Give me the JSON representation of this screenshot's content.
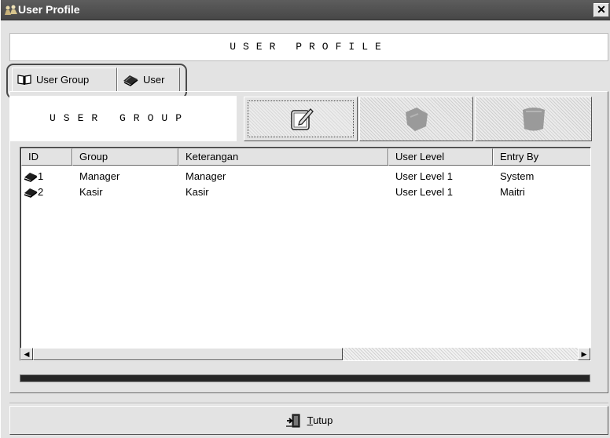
{
  "window": {
    "title": "User Profile",
    "close_glyph": "✕",
    "icon": "users-icon"
  },
  "banner": {
    "text": "USER PROFILE"
  },
  "tabs": [
    {
      "label": "User Group",
      "icon": "book-icon",
      "selected": true
    },
    {
      "label": "User",
      "icon": "user-book-icon",
      "selected": false
    }
  ],
  "group_panel": {
    "label": "USER GROUP",
    "buttons": [
      {
        "name": "new",
        "icon": "new-document-icon",
        "enabled": true
      },
      {
        "name": "edit",
        "icon": "edit-icon",
        "enabled": false
      },
      {
        "name": "delete",
        "icon": "delete-icon",
        "enabled": false
      }
    ]
  },
  "table": {
    "columns": [
      "ID",
      "Group",
      "Keterangan",
      "User Level",
      "Entry By"
    ],
    "rows": [
      {
        "id": "1",
        "group": "Manager",
        "keterangan": "Manager",
        "user_level": "User Level 1",
        "entry_by": "System"
      },
      {
        "id": "2",
        "group": "Kasir",
        "keterangan": "Kasir",
        "user_level": "User Level 1",
        "entry_by": "Maitri"
      }
    ]
  },
  "scrollbar": {
    "left_arrow": "◀",
    "right_arrow": "▶"
  },
  "footer": {
    "close_label_first": "T",
    "close_label_rest": "utup"
  }
}
